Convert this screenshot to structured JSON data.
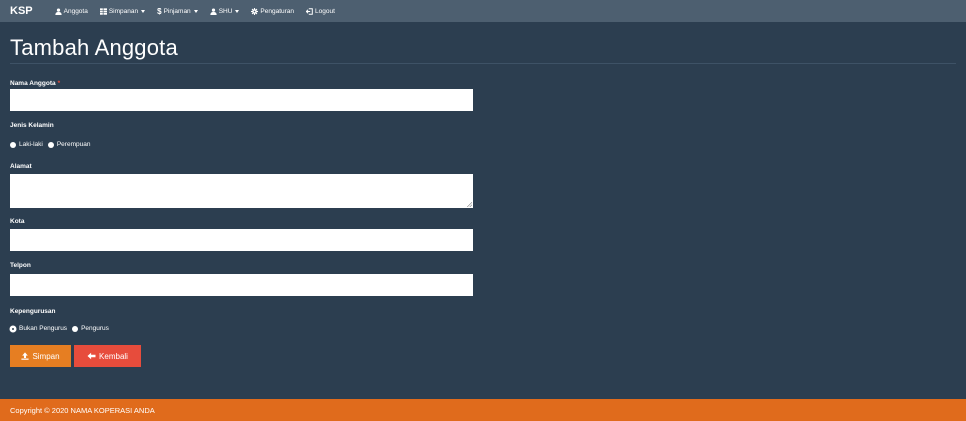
{
  "navbar": {
    "brand": "KSP",
    "items": [
      {
        "label": "Anggota",
        "icon": "user-icon",
        "dropdown": false
      },
      {
        "label": "Simpanan",
        "icon": "table-icon",
        "dropdown": true
      },
      {
        "label": "Pinjaman",
        "icon": "dollar-icon",
        "dropdown": true
      },
      {
        "label": "SHU",
        "icon": "user-icon",
        "dropdown": true
      },
      {
        "label": "Pengaturan",
        "icon": "gear-icon",
        "dropdown": false
      },
      {
        "label": "Logout",
        "icon": "logout-icon",
        "dropdown": false
      }
    ]
  },
  "page": {
    "title": "Tambah Anggota"
  },
  "form": {
    "nama": {
      "label": "Nama Anggota",
      "required_mark": "*",
      "value": ""
    },
    "jenis_kelamin": {
      "label": "Jenis Kelamin",
      "options": [
        "Laki-laki",
        "Perempuan"
      ],
      "selected": null
    },
    "alamat": {
      "label": "Alamat",
      "value": ""
    },
    "kota": {
      "label": "Kota",
      "value": ""
    },
    "telpon": {
      "label": "Telpon",
      "value": ""
    },
    "kepengurusan": {
      "label": "Kepengurusan",
      "options": [
        "Bukan Pengurus",
        "Pengurus"
      ],
      "selected": "Bukan Pengurus"
    },
    "buttons": {
      "save": {
        "label": "Simpan",
        "icon": "upload-icon"
      },
      "back": {
        "label": "Kembali",
        "icon": "arrow-left-icon"
      }
    }
  },
  "footer": {
    "text": "Copyright © 2020 NAMA KOPERASI ANDA"
  },
  "colors": {
    "background": "#2c3e50",
    "navbar": "#4d5f70",
    "save_button": "#e67e22",
    "back_button": "#e74c3c",
    "footer": "#e06b1c"
  }
}
